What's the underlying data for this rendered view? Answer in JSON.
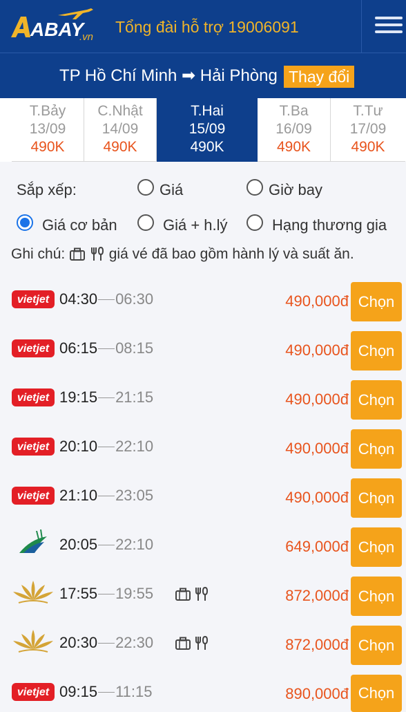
{
  "header": {
    "logo_text": "ABAY",
    "logo_suffix": ".vn",
    "hotline": "Tổng đài hỗ trợ 19006091"
  },
  "route": {
    "from": "TP Hồ Chí Minh",
    "arrow": "➡",
    "to": "Hải Phòng",
    "change_label": "Thay đổi"
  },
  "date_tabs": [
    {
      "day": "T.Bảy",
      "date": "13/09",
      "price": "490K",
      "active": false
    },
    {
      "day": "C.Nhật",
      "date": "14/09",
      "price": "490K",
      "active": false
    },
    {
      "day": "T.Hai",
      "date": "15/09",
      "price": "490K",
      "active": true
    },
    {
      "day": "T.Ba",
      "date": "16/09",
      "price": "490K",
      "active": false
    },
    {
      "day": "T.Tư",
      "date": "17/09",
      "price": "490K",
      "active": false
    }
  ],
  "sort": {
    "label": "Sắp xếp:",
    "options": [
      {
        "label": "Giá",
        "checked": false
      },
      {
        "label": "Giờ bay",
        "checked": false
      },
      {
        "label": "Giá cơ bản",
        "checked": true
      },
      {
        "label": "Giá + h.lý",
        "checked": false
      },
      {
        "label": "Hạng thương gia",
        "checked": false
      }
    ]
  },
  "note": {
    "prefix": "Ghi chú:",
    "text": "giá vé đã bao gồm hành lý và suất ăn."
  },
  "flights": [
    {
      "airline": "vietjet",
      "dep": "04:30",
      "arr": "06:30",
      "amenities": false,
      "price": "490,000đ",
      "button": "Chọn"
    },
    {
      "airline": "vietjet",
      "dep": "06:15",
      "arr": "08:15",
      "amenities": false,
      "price": "490,000đ",
      "button": "Chọn"
    },
    {
      "airline": "vietjet",
      "dep": "19:15",
      "arr": "21:15",
      "amenities": false,
      "price": "490,000đ",
      "button": "Chọn"
    },
    {
      "airline": "vietjet",
      "dep": "20:10",
      "arr": "22:10",
      "amenities": false,
      "price": "490,000đ",
      "button": "Chọn"
    },
    {
      "airline": "vietjet",
      "dep": "21:10",
      "arr": "23:05",
      "amenities": false,
      "price": "490,000đ",
      "button": "Chọn"
    },
    {
      "airline": "bamboo",
      "dep": "20:05",
      "arr": "22:10",
      "amenities": false,
      "price": "649,000đ",
      "button": "Chọn"
    },
    {
      "airline": "vietnam-airlines",
      "dep": "17:55",
      "arr": "19:55",
      "amenities": true,
      "price": "872,000đ",
      "button": "Chọn"
    },
    {
      "airline": "vietnam-airlines",
      "dep": "20:30",
      "arr": "22:30",
      "amenities": true,
      "price": "872,000đ",
      "button": "Chọn"
    },
    {
      "airline": "vietjet",
      "dep": "09:15",
      "arr": "11:15",
      "amenities": false,
      "price": "890,000đ",
      "button": "Chọn"
    }
  ],
  "airline_logo_text": {
    "vietjet": "vietjet"
  },
  "colors": {
    "header_bg": "#0e3f8c",
    "accent_orange": "#f5a31a",
    "price_red": "#e8541d",
    "hotline_gold": "#f0b429",
    "radio_blue": "#1a73e8"
  }
}
